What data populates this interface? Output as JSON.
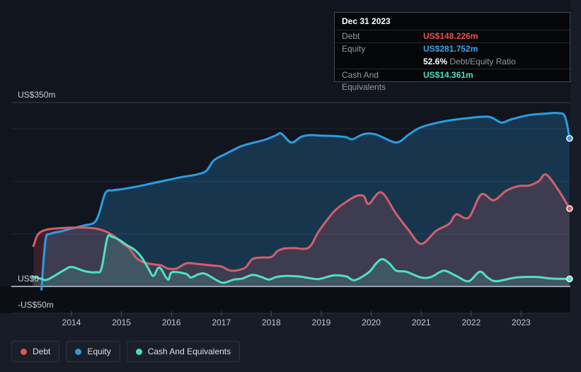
{
  "chart": {
    "y_axis_labels": [
      {
        "text": "US$350m",
        "value": 350
      },
      {
        "text": "US$0",
        "value": 0
      },
      {
        "text": "-US$50m",
        "value": -50
      }
    ],
    "x_axis_ticks": [
      2014,
      2015,
      2016,
      2017,
      2018,
      2019,
      2020,
      2021,
      2022,
      2023
    ]
  },
  "tooltip": {
    "date": "Dec 31 2023",
    "debt_label": "Debt",
    "debt_value": "US$148.226m",
    "equity_label": "Equity",
    "equity_value": "US$281.752m",
    "ratio_percent": "52.6%",
    "ratio_text": "Debt/Equity Ratio",
    "cash_label": "Cash And Equivalents",
    "cash_value": "US$14.361m"
  },
  "legend": {
    "items": [
      {
        "label": "Debt",
        "color": "#e2544c"
      },
      {
        "label": "Equity",
        "color": "#2e9ade"
      },
      {
        "label": "Cash And Equivalents",
        "color": "#46ddbc"
      }
    ]
  },
  "chart_data": {
    "type": "area",
    "title": "Debt to Equity History",
    "unit": "US$ millions",
    "x_range": [
      2013.2,
      2023.97
    ],
    "y_gridlines": [
      350,
      300,
      200,
      100
    ],
    "y_zero_line": 0,
    "legend_position": "bottom-left",
    "series": [
      {
        "name": "Equity",
        "line_color": "#2b9de4",
        "fill_color": "rgba(45,150,215,0.26)",
        "points": [
          [
            2013.4,
            -6
          ],
          [
            2013.48,
            88
          ],
          [
            2013.58,
            100
          ],
          [
            2013.8,
            105
          ],
          [
            2014.0,
            110
          ],
          [
            2014.25,
            116
          ],
          [
            2014.45,
            121
          ],
          [
            2014.55,
            138
          ],
          [
            2014.68,
            178
          ],
          [
            2014.82,
            183
          ],
          [
            2015.0,
            185
          ],
          [
            2015.3,
            190
          ],
          [
            2015.6,
            196
          ],
          [
            2015.9,
            202
          ],
          [
            2016.2,
            208
          ],
          [
            2016.5,
            213
          ],
          [
            2016.7,
            220
          ],
          [
            2016.85,
            240
          ],
          [
            2017.1,
            253
          ],
          [
            2017.4,
            267
          ],
          [
            2017.62,
            273
          ],
          [
            2017.9,
            280
          ],
          [
            2018.1,
            288
          ],
          [
            2018.2,
            291
          ],
          [
            2018.4,
            274
          ],
          [
            2018.6,
            285
          ],
          [
            2018.78,
            288
          ],
          [
            2019.0,
            287
          ],
          [
            2019.3,
            286
          ],
          [
            2019.5,
            284
          ],
          [
            2019.62,
            280
          ],
          [
            2019.85,
            290
          ],
          [
            2020.1,
            289
          ],
          [
            2020.5,
            274
          ],
          [
            2020.75,
            289
          ],
          [
            2021.0,
            303
          ],
          [
            2021.45,
            314
          ],
          [
            2021.9,
            320
          ],
          [
            2022.35,
            323
          ],
          [
            2022.6,
            312
          ],
          [
            2022.8,
            318
          ],
          [
            2023.15,
            326
          ],
          [
            2023.5,
            329
          ],
          [
            2023.75,
            330
          ],
          [
            2023.88,
            323
          ],
          [
            2023.97,
            281.752
          ]
        ]
      },
      {
        "name": "Debt",
        "line_color": "#d25f6a",
        "fill_color": "rgba(218,84,94,0.20)",
        "points": [
          [
            2013.24,
            77
          ],
          [
            2013.33,
            99
          ],
          [
            2013.5,
            108
          ],
          [
            2013.8,
            111
          ],
          [
            2014.2,
            112
          ],
          [
            2014.5,
            110
          ],
          [
            2014.7,
            104
          ],
          [
            2014.85,
            96
          ],
          [
            2015.02,
            82
          ],
          [
            2015.16,
            72
          ],
          [
            2015.3,
            54
          ],
          [
            2015.44,
            46
          ],
          [
            2015.64,
            42
          ],
          [
            2015.8,
            40
          ],
          [
            2015.93,
            34
          ],
          [
            2016.1,
            34
          ],
          [
            2016.3,
            44
          ],
          [
            2016.5,
            43
          ],
          [
            2016.8,
            40
          ],
          [
            2017.0,
            38
          ],
          [
            2017.15,
            31
          ],
          [
            2017.28,
            30
          ],
          [
            2017.48,
            36
          ],
          [
            2017.62,
            52
          ],
          [
            2017.8,
            55
          ],
          [
            2018.0,
            56
          ],
          [
            2018.12,
            67
          ],
          [
            2018.25,
            72
          ],
          [
            2018.45,
            73
          ],
          [
            2018.75,
            74
          ],
          [
            2018.95,
            105
          ],
          [
            2019.25,
            142
          ],
          [
            2019.47,
            159
          ],
          [
            2019.7,
            172
          ],
          [
            2019.85,
            172
          ],
          [
            2019.95,
            157
          ],
          [
            2020.2,
            179
          ],
          [
            2020.5,
            138
          ],
          [
            2020.75,
            107
          ],
          [
            2021.0,
            81
          ],
          [
            2021.3,
            106
          ],
          [
            2021.56,
            119
          ],
          [
            2021.7,
            137
          ],
          [
            2021.95,
            131
          ],
          [
            2022.2,
            175
          ],
          [
            2022.45,
            164
          ],
          [
            2022.7,
            182
          ],
          [
            2022.95,
            191
          ],
          [
            2023.15,
            192
          ],
          [
            2023.35,
            200
          ],
          [
            2023.5,
            213
          ],
          [
            2023.75,
            183
          ],
          [
            2023.97,
            148.226
          ]
        ]
      },
      {
        "name": "Cash And Equivalents",
        "line_color": "#4ee2c2",
        "fill_color": "rgba(78,226,194,0.16)",
        "points": [
          [
            2013.22,
            19
          ],
          [
            2013.38,
            15
          ],
          [
            2013.52,
            13
          ],
          [
            2013.85,
            31
          ],
          [
            2014.01,
            37
          ],
          [
            2014.27,
            29
          ],
          [
            2014.5,
            27
          ],
          [
            2014.6,
            34
          ],
          [
            2014.72,
            93
          ],
          [
            2014.82,
            94
          ],
          [
            2014.95,
            89
          ],
          [
            2015.12,
            78
          ],
          [
            2015.26,
            70
          ],
          [
            2015.4,
            56
          ],
          [
            2015.54,
            34
          ],
          [
            2015.64,
            20
          ],
          [
            2015.76,
            36
          ],
          [
            2015.93,
            13
          ],
          [
            2016.01,
            27
          ],
          [
            2016.29,
            24
          ],
          [
            2016.39,
            17
          ],
          [
            2016.54,
            23
          ],
          [
            2016.68,
            24
          ],
          [
            2016.92,
            11
          ],
          [
            2017.05,
            7
          ],
          [
            2017.25,
            13
          ],
          [
            2017.42,
            15
          ],
          [
            2017.62,
            22
          ],
          [
            2017.8,
            18
          ],
          [
            2017.95,
            13
          ],
          [
            2018.1,
            18
          ],
          [
            2018.3,
            20
          ],
          [
            2018.55,
            19
          ],
          [
            2018.75,
            16
          ],
          [
            2018.95,
            14
          ],
          [
            2019.25,
            21
          ],
          [
            2019.5,
            19
          ],
          [
            2019.67,
            12
          ],
          [
            2019.95,
            27
          ],
          [
            2020.1,
            44
          ],
          [
            2020.22,
            52
          ],
          [
            2020.36,
            44
          ],
          [
            2020.5,
            30
          ],
          [
            2020.7,
            28
          ],
          [
            2021.0,
            17
          ],
          [
            2021.2,
            18
          ],
          [
            2021.45,
            30
          ],
          [
            2021.7,
            20
          ],
          [
            2021.95,
            10
          ],
          [
            2022.17,
            28
          ],
          [
            2022.33,
            17
          ],
          [
            2022.5,
            10
          ],
          [
            2022.9,
            17
          ],
          [
            2023.3,
            18
          ],
          [
            2023.6,
            15
          ],
          [
            2023.97,
            14.361
          ]
        ]
      }
    ]
  }
}
